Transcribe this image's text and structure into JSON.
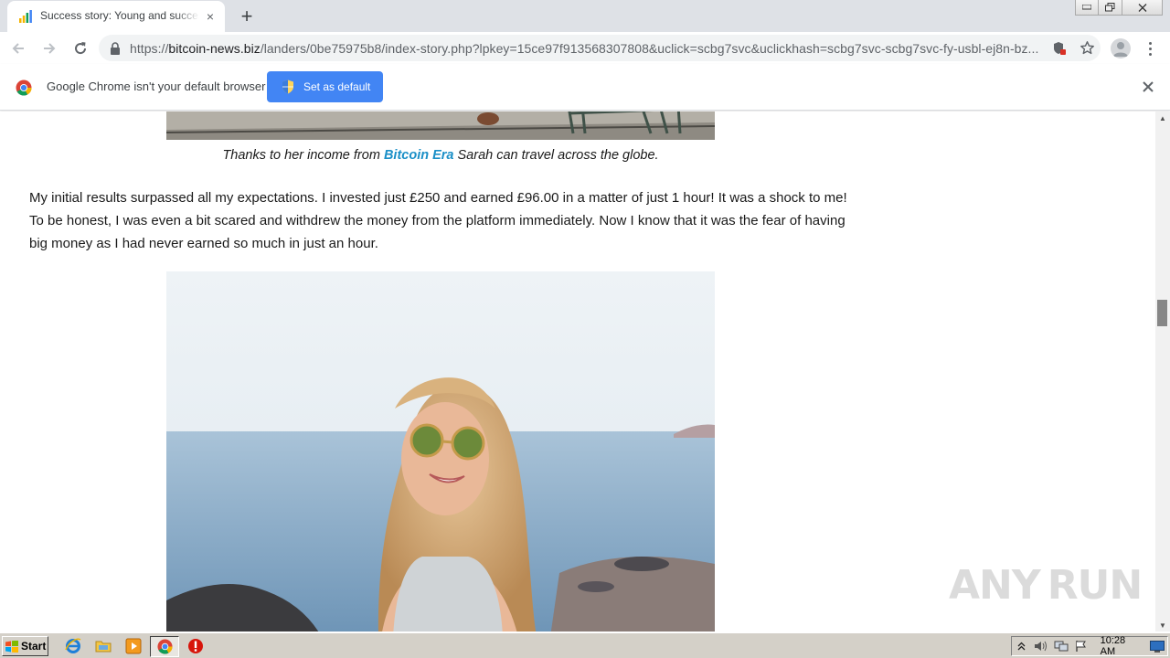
{
  "browser": {
    "tab": {
      "title": "Success story: Young and successful",
      "close_icon": "×"
    },
    "new_tab_icon": "+",
    "window_controls": {
      "minimize": "▭",
      "restore": "❐",
      "close": "✕"
    },
    "url": {
      "scheme": "https://",
      "host": "bitcoin-news.biz",
      "path": "/landers/0be75975b8/index-story.php?lpkey=15ce97f913568307808&uclick=scbg7svc&uclickhash=scbg7svc-scbg7svc-fy-usbl-ej8n-bz..."
    },
    "nav": {
      "back": "←",
      "forward": "→",
      "reload": "↻"
    }
  },
  "infobar": {
    "message": "Google Chrome isn't your default browser",
    "button_label": "Set as default",
    "close_icon": "✕"
  },
  "article": {
    "caption_before": "Thanks to her income from ",
    "caption_brand": "Bitcoin Era",
    "caption_after": " Sarah can travel across the globe.",
    "paragraph": "My initial results surpassed all my expectations. I invested just £250 and earned £96.00 in a matter of just 1 hour! It was a shock to me! To be honest, I was even a bit scared and withdrew the money from the platform immediately. Now I know that it was the fear of having big money as I had never earned so much in just an hour."
  },
  "watermark": {
    "left": "ANY",
    "right": "RUN"
  },
  "taskbar": {
    "start_label": "Start",
    "clock": "10:28 AM"
  },
  "colors": {
    "brand_link": "#1a8fc7",
    "default_button": "#4285f4",
    "tab_strip": "#dee1e6",
    "taskbar": "#d4d0c8"
  }
}
